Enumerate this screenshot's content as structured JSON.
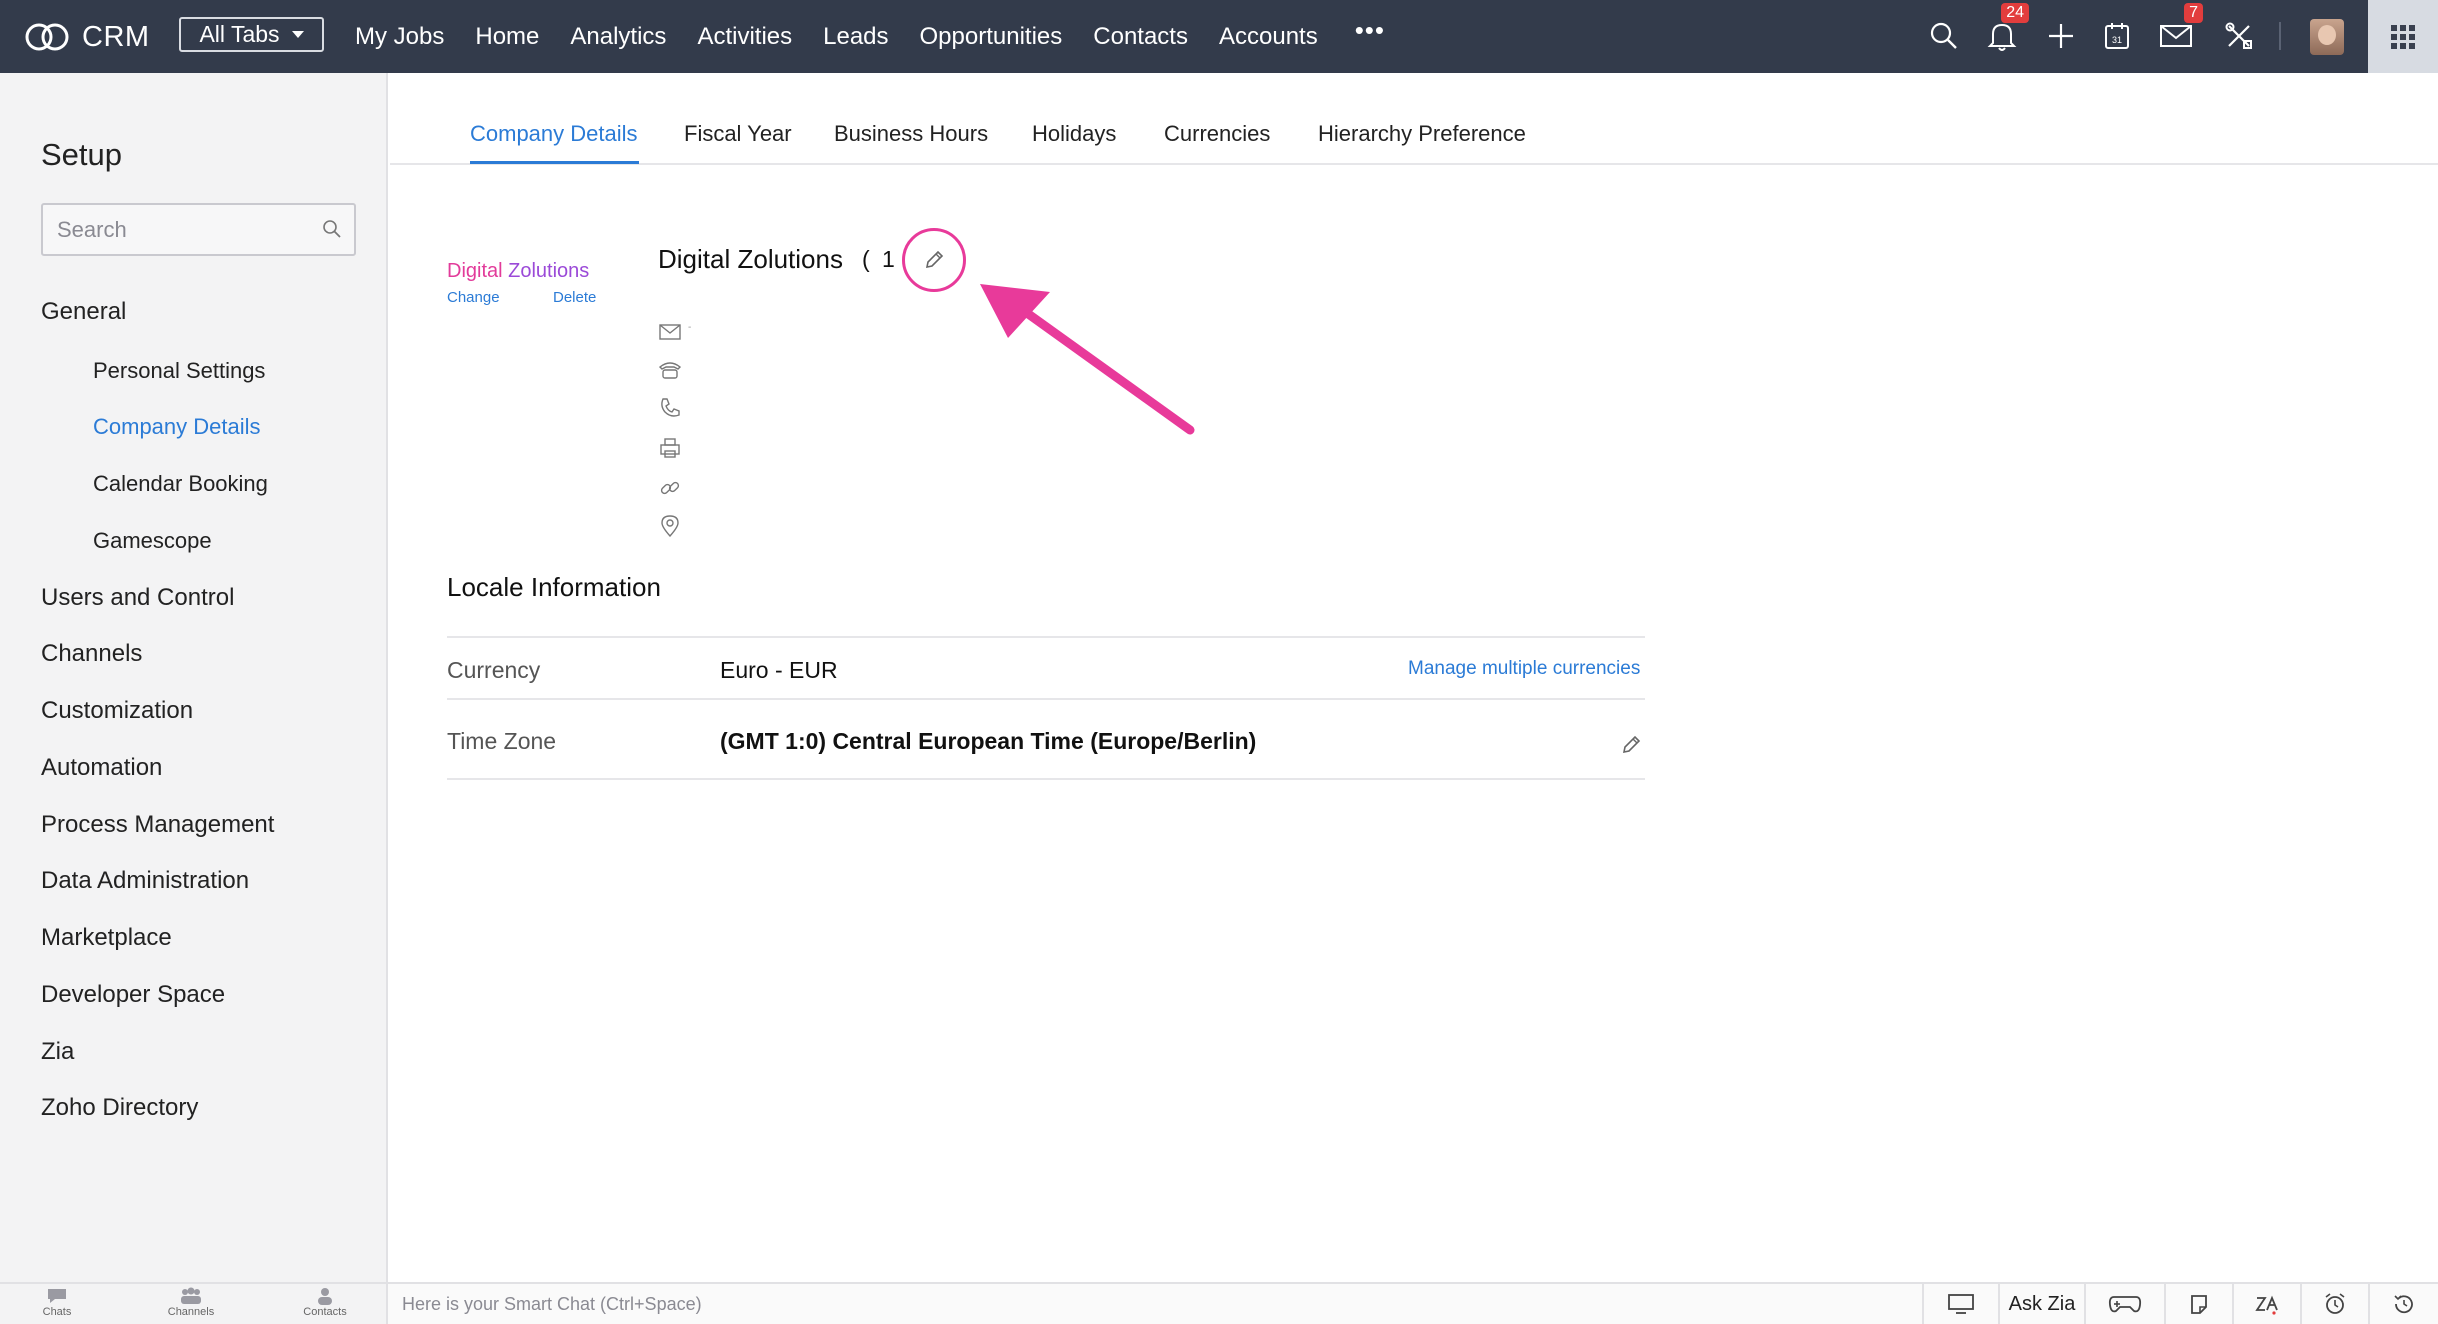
{
  "topbar": {
    "brand": "CRM",
    "all_tabs": "All Tabs",
    "nav": [
      "My Jobs",
      "Home",
      "Analytics",
      "Activities",
      "Leads",
      "Opportunities",
      "Contacts",
      "Accounts"
    ],
    "more": "•••",
    "notifications_count": "24",
    "mail_count": "7",
    "icons": [
      "search-icon",
      "bell-icon",
      "plus-icon",
      "calendar-icon",
      "mail-icon",
      "tools-icon",
      "avatar",
      "apps-grid-icon"
    ],
    "calendar_day": "31"
  },
  "sidebar": {
    "title": "Setup",
    "search_placeholder": "Search",
    "general": "General",
    "general_items": [
      "Personal Settings",
      "Company Details",
      "Calendar Booking",
      "Gamescope"
    ],
    "active_item": "Company Details",
    "sections": [
      "Users and Control",
      "Channels",
      "Customization",
      "Automation",
      "Process Management",
      "Data Administration",
      "Marketplace",
      "Developer Space",
      "Zia",
      "Zoho Directory"
    ]
  },
  "tabs": {
    "items": [
      "Company Details",
      "Fiscal Year",
      "Business Hours",
      "Holidays",
      "Currencies",
      "Hierarchy Preference"
    ],
    "active": "Company Details"
  },
  "company": {
    "logo_text_a": "Digital ",
    "logo_text_b": "Zolutions",
    "change": "Change",
    "delete": "Delete",
    "name": "Digital Zolutions",
    "count": "( 1 )",
    "email_value": "-",
    "detail_icons": [
      "mail-icon",
      "telephone-icon",
      "phone-icon",
      "fax-icon",
      "link-icon",
      "location-icon"
    ]
  },
  "locale": {
    "title": "Locale Information",
    "currency_label": "Currency",
    "currency_value": "Euro - EUR",
    "manage_link": "Manage multiple currencies",
    "timezone_label": "Time Zone",
    "timezone_value": "(GMT 1:0) Central European Time (Europe/Berlin)"
  },
  "colors": {
    "topbar_bg": "#333b4b",
    "accent": "#2b7bd6",
    "annotation": "#e83a9a",
    "badge": "#e23d3d"
  },
  "bottombar": {
    "items": [
      "Chats",
      "Channels",
      "Contacts"
    ],
    "smart_chat": "Here is your Smart Chat (Ctrl+Space)",
    "ask_zia": "Ask Zia"
  }
}
